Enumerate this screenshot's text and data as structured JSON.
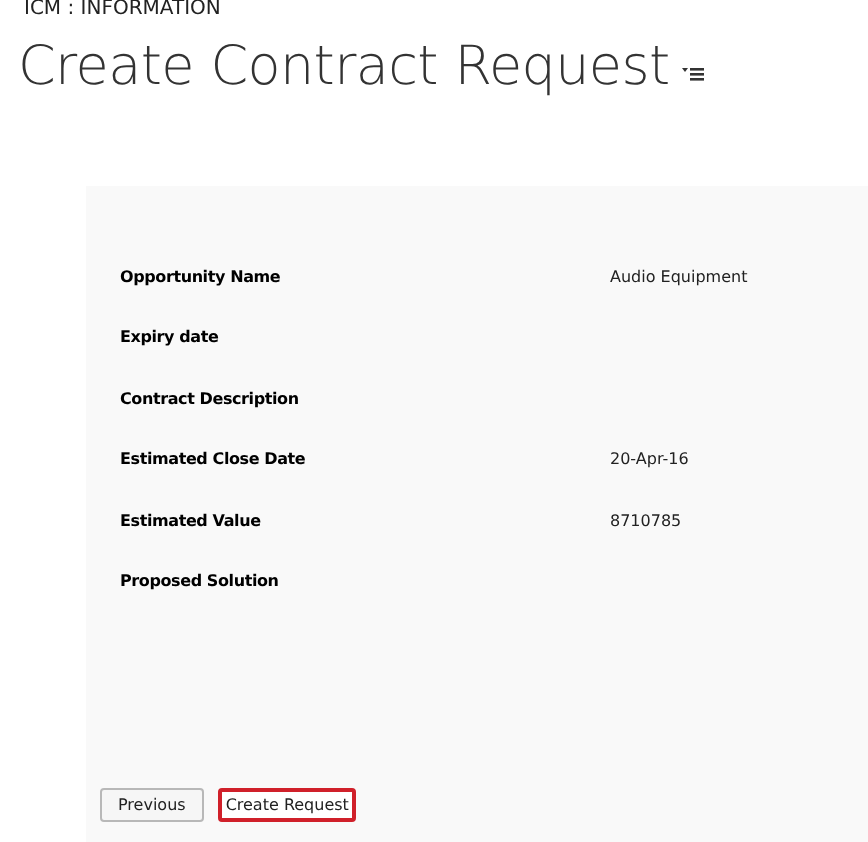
{
  "breadcrumb": "ICM : INFORMATION",
  "title": "Create Contract Request",
  "fields": [
    {
      "label": "Opportunity Name",
      "value": "Audio Equipment"
    },
    {
      "label": "Expiry date"
    },
    {
      "label": "Contract Description"
    },
    {
      "label": "Estimated Close Date",
      "value": "20-Apr-16"
    },
    {
      "label": "Estimated Value",
      "value": "8710785"
    },
    {
      "label": "Proposed Solution"
    }
  ],
  "buttons": [
    {
      "label": "Previous",
      "focused": false
    },
    {
      "label": "Create Request",
      "focused": true
    }
  ]
}
